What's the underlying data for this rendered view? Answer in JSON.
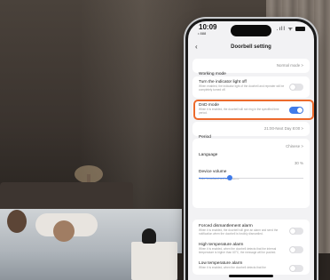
{
  "status_bar": {
    "time": "10:09",
    "sub": "• 888",
    "icons": ".ıll ᯤ"
  },
  "header": {
    "back_icon": "chevron-left-icon",
    "title": "Doorbell setting"
  },
  "working_mode": {
    "label": "Working mode",
    "value": "Normal mode",
    "chevron": ">"
  },
  "indicator": {
    "label": "Turn the indicator light off",
    "desc": "When enabled, the indicator light of the doorbell and repeater will be completely turned off.",
    "enabled": false
  },
  "dnd": {
    "label": "DnD mode",
    "desc": "When it is enabled, the doorbell will not ring in the specified time period.",
    "enabled": true,
    "highlight_color": "#ec6a2c"
  },
  "period": {
    "label": "Period",
    "value": "21:00-Next Day 8:00",
    "chevron": ">"
  },
  "language": {
    "label": "Language",
    "value": "Chinese",
    "chevron": ">"
  },
  "volume": {
    "label": "Device volume",
    "value": "30 %",
    "desc": "Voice broadcast and call volume",
    "level": 0.3
  },
  "dismantle": {
    "label": "Forced dismantlement alarm",
    "desc": "When it is enabled, the doorbell will give an alarm and send the notification when the doorbell is forcibly dismantled.",
    "enabled": false
  },
  "high_temp": {
    "label": "High temperature alarm",
    "desc": "When it is enabled, when the doorbell detects that the internal temperature is higher than 60°C, the message will be pushed.",
    "enabled": false
  },
  "low_temp": {
    "label": "Low temperature alarm",
    "desc": "When it is enabled, when the doorbell detects that the",
    "enabled": false
  },
  "colors": {
    "accent": "#3f7bea",
    "highlight": "#ec6a2c"
  }
}
